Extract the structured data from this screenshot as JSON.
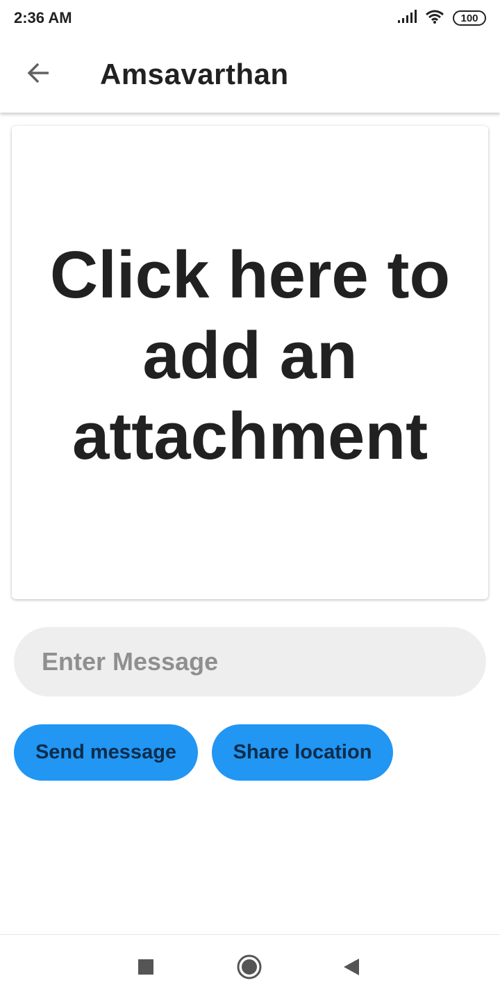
{
  "status_bar": {
    "time": "2:36 AM",
    "battery": "100",
    "icons": [
      "signal-icon",
      "wifi-icon",
      "battery-icon"
    ]
  },
  "app_bar": {
    "back_icon": "arrow-left-icon",
    "title": "Amsavarthan"
  },
  "attachment": {
    "prompt": "Click here to add an attachment"
  },
  "message": {
    "placeholder": "Enter Message",
    "value": ""
  },
  "actions": {
    "send_label": "Send message",
    "share_label": "Share location"
  },
  "nav_bar": {
    "icons": [
      "recents-square-icon",
      "home-circle-icon",
      "back-triangle-icon"
    ]
  },
  "colors": {
    "accent": "#2196f3",
    "button_text": "#0d2c4a",
    "input_background": "#eeeeee",
    "text_primary": "#212121"
  }
}
